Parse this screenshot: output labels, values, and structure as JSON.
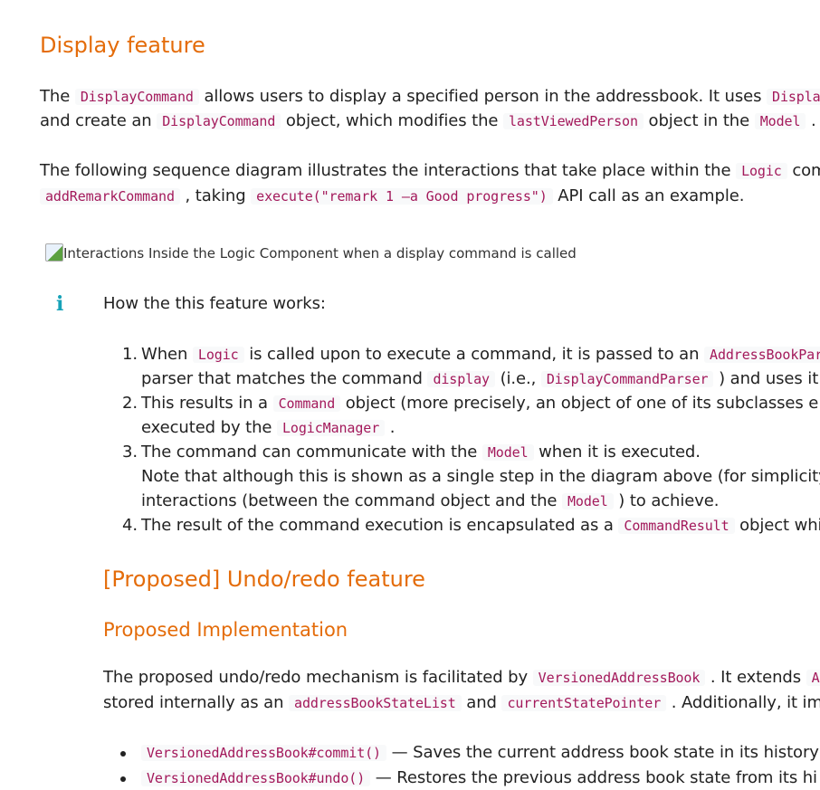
{
  "display_section": {
    "heading": "Display feature",
    "p1": {
      "t1": "The ",
      "c1": "DisplayCommand",
      "t2": " allows users to display a specified person in the addressbook. It uses ",
      "c2": "Displa",
      "t3": "and create an ",
      "c3": "DisplayCommand",
      "t4": " object, which modifies the ",
      "c4": "lastViewedPerson",
      "t5": " object in the ",
      "c5": "Model",
      "t6": " ."
    },
    "p2": {
      "t1": "The following sequence diagram illustrates the interactions that take place within the ",
      "c1": "Logic",
      "t2": " comp",
      "c2": "addRemarkCommand",
      "t3": " , taking ",
      "c3": "execute(\"remark 1 –a Good progress\")",
      "t4": " API call as an example."
    },
    "image_alt": "Interactions Inside the Logic Component when a display command is called",
    "info_icon": "i",
    "info_title": "How the this feature works:",
    "steps": {
      "s1": {
        "num": "1.",
        "t1": "When ",
        "c1": "Logic",
        "t2": " is called upon to execute a command, it is passed to an ",
        "c2": "AddressBookPar",
        "t3": "parser that matches the command ",
        "c3": "display",
        "t4": " (i.e., ",
        "c4": "DisplayCommandParser",
        "t5": " ) and uses it"
      },
      "s2": {
        "num": "2.",
        "t1": "This results in a ",
        "c1": "Command",
        "t2": " object (more precisely, an object of one of its subclasses e.g",
        "t3": "executed by the ",
        "c2": "LogicManager",
        "t4": " ."
      },
      "s3": {
        "num": "3.",
        "t1": "The command can communicate with the ",
        "c1": "Model",
        "t2": " when it is executed.",
        "t3": "Note that although this is shown as a single step in the diagram above (for simplicity),",
        "t4": "interactions (between the command object and the ",
        "c2": "Model",
        "t5": " ) to achieve."
      },
      "s4": {
        "num": "4.",
        "t1": "The result of the command execution is encapsulated as a ",
        "c1": "CommandResult",
        "t2": " object whic"
      }
    }
  },
  "undo_section": {
    "heading": "[Proposed] Undo/redo feature",
    "subheading": "Proposed Implementation",
    "p1": {
      "t1": "The proposed undo/redo mechanism is facilitated by ",
      "c1": "VersionedAddressBook",
      "t2": " . It extends ",
      "c2": "Ad",
      "t3": "stored internally as an ",
      "c3": "addressBookStateList",
      "t4": " and ",
      "c4": "currentStatePointer",
      "t5": " . Additionally, it im"
    },
    "bullets": {
      "b1": {
        "code": "VersionedAddressBook#commit()",
        "text": " — Saves the current address book state in its history"
      },
      "b2": {
        "code": "VersionedAddressBook#undo()",
        "text": " — Restores the previous address book state from its hi"
      }
    }
  }
}
